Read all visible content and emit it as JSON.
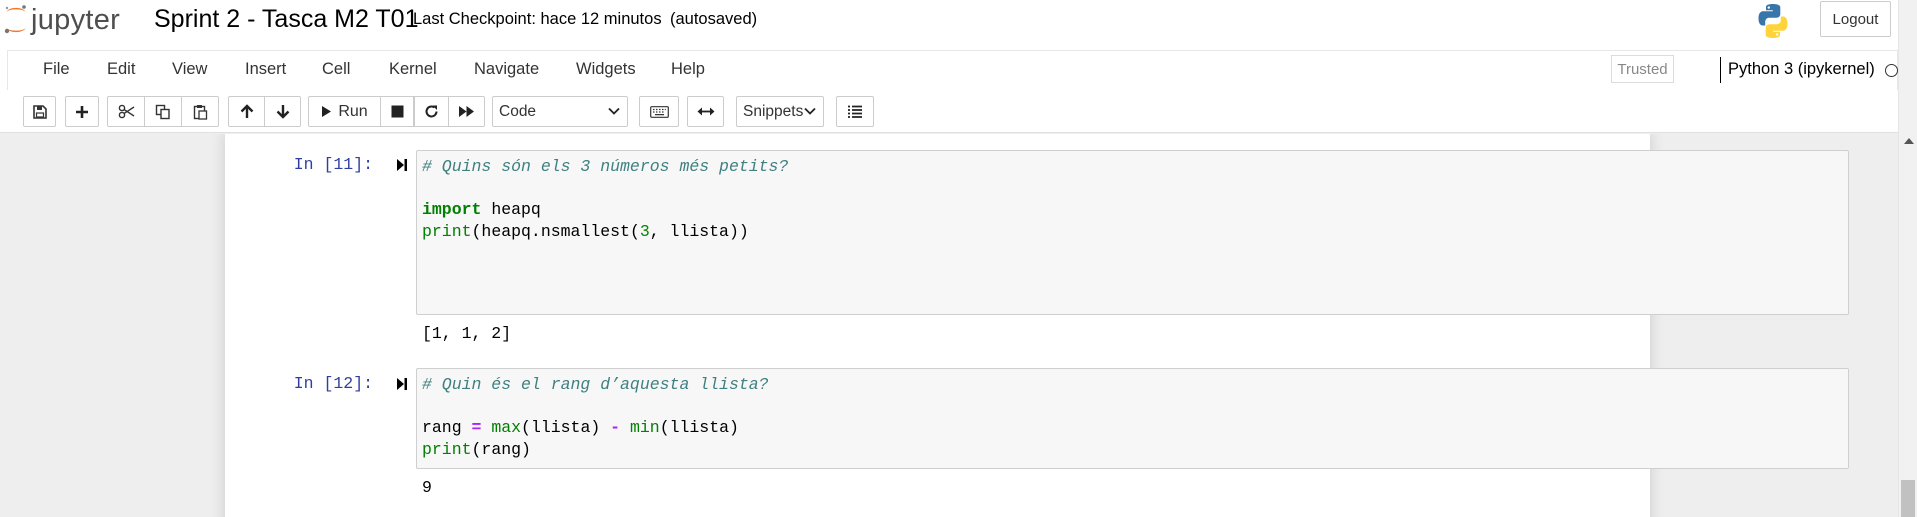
{
  "header": {
    "logo_text": "jupyter",
    "title": "Sprint 2 - Tasca M2 T01",
    "checkpoint": "Last Checkpoint: hace 12 minutos",
    "autosave_status": "(autosaved)",
    "logout_label": "Logout"
  },
  "menubar": {
    "items": [
      "File",
      "Edit",
      "View",
      "Insert",
      "Cell",
      "Kernel",
      "Navigate",
      "Widgets",
      "Help"
    ],
    "trusted_label": "Trusted",
    "kernel_name": "Python 3 (ipykernel)"
  },
  "toolbar": {
    "run_label": "Run",
    "cell_type": "Code",
    "snippets_label": "Snippets"
  },
  "cells": [
    {
      "prompt": "In [11]:",
      "code": {
        "comment": "# Quins són els 3 números més petits?",
        "l2_kw": "import",
        "l2_rest": " heapq",
        "l3_fn": "print",
        "l3_a": "(heapq.nsmallest(",
        "l3_num": "3",
        "l3_b": ", llista))"
      },
      "output": "[1, 1, 2]"
    },
    {
      "prompt": "In [12]:",
      "code": {
        "comment": "# Quin és el rang d’aquesta llista?",
        "l2_a": "rang ",
        "l2_eq": "=",
        "l2_sp": " ",
        "l2_max": "max",
        "l2_b": "(llista) ",
        "l2_minus": "-",
        "l2_sp2": " ",
        "l2_min": "min",
        "l2_c": "(llista)",
        "l3_fn": "print",
        "l3_a": "(rang)"
      },
      "output": "9"
    }
  ],
  "colors": {
    "prompt": "#303f9f",
    "comment": "#408080",
    "keyword": "#008000",
    "operator": "#aa22ff",
    "jupyter_orange": "#f37726"
  }
}
